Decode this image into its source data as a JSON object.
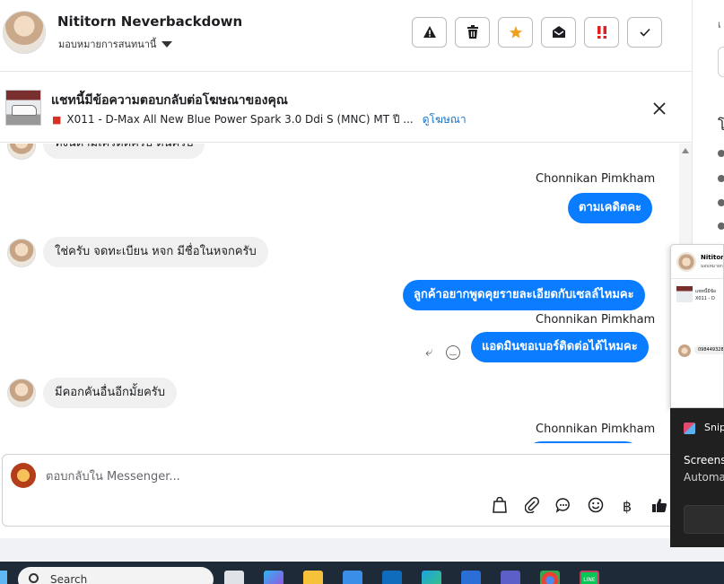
{
  "header": {
    "contact_name": "Nititorn Neverbackdown",
    "assign_label": "มอบหมายการสนทนานี้",
    "actions": [
      {
        "icon": "warning-icon",
        "label": "Report"
      },
      {
        "icon": "trash-icon",
        "label": "Delete"
      },
      {
        "icon": "star-icon",
        "label": "Star"
      },
      {
        "icon": "mark-read-icon",
        "label": "Mark read"
      },
      {
        "icon": "priority-icon",
        "label": "Priority"
      },
      {
        "icon": "check-icon",
        "label": "Done"
      }
    ]
  },
  "ad_banner": {
    "title": "แชทนี้มีข้อความตอบกลับต่อโฆษณาของคุณ",
    "subtitle": "X011 - D-Max All New Blue Power Spark 3.0 Ddi S (MNC) MT ปี ...",
    "link": "ดูโฆษณา"
  },
  "chat": {
    "partial_top": "ทั้งนี้ตามเครดิตครับ ต้นครับ",
    "messages": [
      {
        "from": "agent",
        "sender": "Chonnikan Pimkham",
        "text": "ตามเคดิตคะ"
      },
      {
        "from": "customer",
        "text": "ใช่ครับ จดทะเบียน หจก มีชื่อในหจกครับ"
      },
      {
        "from": "agent",
        "text": "ลูกค้าอยากพูดคุยรายละเอียดกับเซลล์ไหมคะ"
      },
      {
        "from": "agent",
        "sender": "Chonnikan Pimkham",
        "text": "แอดมินขอเบอร์ติดต่อได้ไหมคะ"
      },
      {
        "from": "customer",
        "text": "มีคอกคันอื่นอีกมั้ยครับ"
      },
      {
        "from": "agent",
        "sender": "Chonnikan Pimkham",
        "text": ""
      }
    ]
  },
  "composer": {
    "placeholder": "ตอบกลับใน Messenger...",
    "tools": [
      "bag-icon",
      "paperclip-icon",
      "chat-bubble-icon",
      "emoji-icon",
      "baht-icon",
      "thumbs-up-icon"
    ],
    "baht_symbol": "฿"
  },
  "right_panel": {
    "frag_top": "เ",
    "frag_mid": "โ"
  },
  "popup": {
    "name": "Nititorn",
    "sub": "มอบหมายการ",
    "ad_line1": "แชทนี้มีข้อ",
    "ad_line2": "X011 - D",
    "bubble": "098449328"
  },
  "toast": {
    "app": "Snip",
    "title": "Screens",
    "body": "Automa"
  },
  "taskbar": {
    "search_placeholder": "Search",
    "apps": [
      "explorer-app",
      "copilot-app",
      "folder-app",
      "store-app",
      "outlook-app",
      "edge-app",
      "plus-app",
      "teams-app",
      "chrome-app",
      "line-app"
    ],
    "line_label": "LINE"
  },
  "colors": {
    "accent": "#0a7cff",
    "bubble_in": "#f0f0f0",
    "star": "#f0a020",
    "priority": "#e02020",
    "link": "#1a73c8"
  }
}
